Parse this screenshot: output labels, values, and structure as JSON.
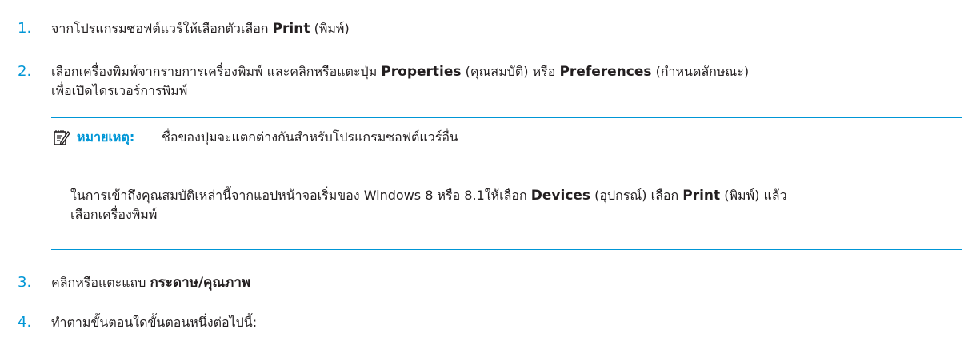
{
  "steps": [
    {
      "number": "1.",
      "text_a": "จากโปรแกรมซอฟต์แวร์ให้เลือกตัวเลือก ",
      "bold_a": "Print",
      "text_b": " (พิมพ์)"
    },
    {
      "number": "2.",
      "text_a": "เลือกเครื่องพิมพ์จากรายการเครื่องพิมพ์ และคลิกหรือแตะปุ่ม ",
      "bold_a": "Properties",
      "text_b": " (คุณสมบัติ) หรือ ",
      "bold_b": "Preferences",
      "text_c": " (กำหนดลักษณะ)",
      "line2": "เพื่อเปิดไดรเวอร์การพิมพ์"
    },
    {
      "number": "3.",
      "text_a": "คลิกหรือแตะแถบ ",
      "bold_a": "กระดาษ/คุณภาพ"
    },
    {
      "number": "4.",
      "text_a": "ทำตามขั้นตอนใดขั้นตอนหนึ่งต่อไปนี้:"
    }
  ],
  "note": {
    "icon": "note-pencil-icon",
    "label": "หมายเหตุ:",
    "text": "ชื่อของปุ่มจะแตกต่างกันสำหรับโปรแกรมซอฟต์แวร์อื่น",
    "body_a": "ในการเข้าถึงคุณสมบัติเหล่านี้จากแอปหน้าจอเริ่มของ Windows 8 หรือ 8.1ให้เลือก ",
    "body_bold_a": "Devices",
    "body_b": " (อุปกรณ์) เลือก ",
    "body_bold_b": "Print",
    "body_c": " (พิมพ์) แล้ว",
    "body_line2": "เลือกเครื่องพิมพ์"
  },
  "colors": {
    "accent": "#0096d6",
    "text": "#231f20"
  }
}
